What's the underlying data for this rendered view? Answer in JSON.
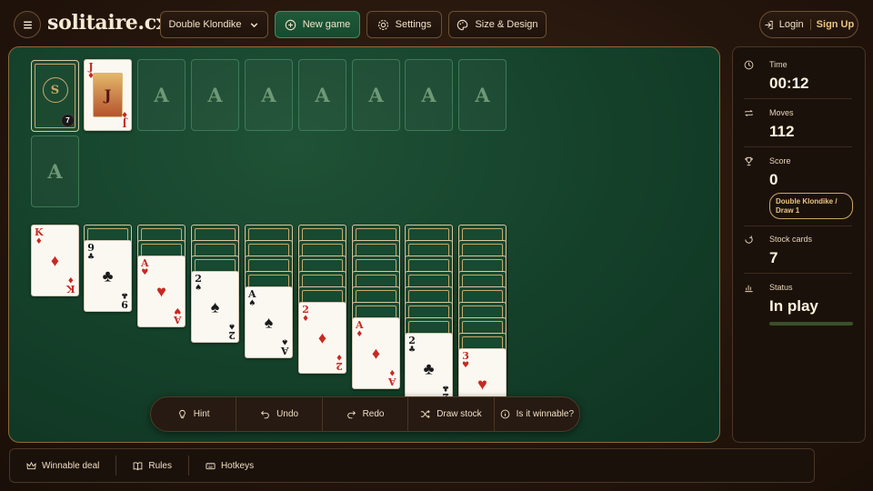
{
  "header": {
    "menu_icon": "hamburger-icon",
    "logo": "solitaire.cx",
    "game_mode": "Double Klondike",
    "new_game": "New game",
    "settings": "Settings",
    "size_design": "Size & Design",
    "login": "Login",
    "signup": "Sign Up"
  },
  "board": {
    "stock_count": "7",
    "stock_emblem": "S",
    "waste_card": {
      "rank": "J",
      "suit": "♦",
      "color": "red"
    },
    "foundation_label": "A",
    "foundation_count": 8
  },
  "tableau": [
    {
      "hidden": 0,
      "cards": [
        {
          "rank": "K",
          "suit": "♦",
          "color": "red"
        }
      ]
    },
    {
      "hidden": 1,
      "cards": [
        {
          "rank": "9",
          "suit": "♣",
          "color": "black"
        }
      ]
    },
    {
      "hidden": 2,
      "cards": [
        {
          "rank": "A",
          "suit": "♥",
          "color": "red"
        }
      ]
    },
    {
      "hidden": 3,
      "cards": [
        {
          "rank": "2",
          "suit": "♠",
          "color": "black"
        }
      ]
    },
    {
      "hidden": 4,
      "cards": [
        {
          "rank": "A",
          "suit": "♠",
          "color": "black"
        }
      ]
    },
    {
      "hidden": 5,
      "cards": [
        {
          "rank": "2",
          "suit": "♦",
          "color": "red"
        }
      ]
    },
    {
      "hidden": 6,
      "cards": [
        {
          "rank": "A",
          "suit": "♦",
          "color": "red"
        }
      ]
    },
    {
      "hidden": 7,
      "cards": [
        {
          "rank": "2",
          "suit": "♣",
          "color": "black"
        }
      ]
    },
    {
      "hidden": 8,
      "cards": [
        {
          "rank": "3",
          "suit": "♥",
          "color": "red"
        }
      ]
    }
  ],
  "actions": {
    "hint": "Hint",
    "undo": "Undo",
    "redo": "Redo",
    "draw_stock": "Draw stock",
    "winnable": "Is it winnable?"
  },
  "stats": {
    "time_label": "Time",
    "time": "00:12",
    "moves_label": "Moves",
    "moves": "112",
    "score_label": "Score",
    "score": "0",
    "mode_badge": "Double Klondike / Draw 1",
    "stock_label": "Stock cards",
    "stock": "7",
    "status_label": "Status",
    "status": "In play"
  },
  "footer": {
    "winnable_deal": "Winnable deal",
    "rules": "Rules",
    "hotkeys": "Hotkeys"
  },
  "colors": {
    "felt": "#14402a",
    "accent_green": "#1f5a3a",
    "gold": "#c9a86a",
    "red_suit": "#c62a23"
  }
}
